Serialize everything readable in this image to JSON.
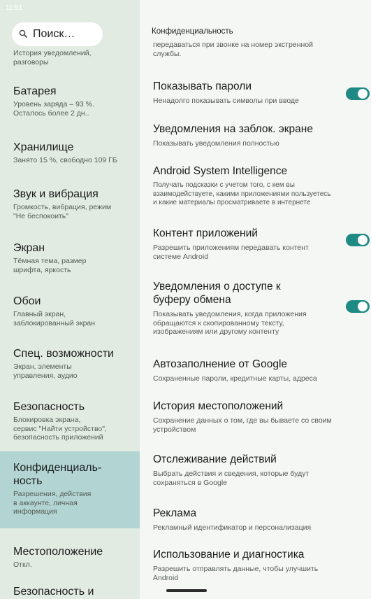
{
  "status": {
    "time": "11:51",
    "battery_glyph": "▮"
  },
  "search": {
    "placeholder": "Поиск…"
  },
  "sidebar": {
    "items": [
      {
        "title": "",
        "subtitle": "История уведомлений,\nразговоры"
      },
      {
        "title": "Батарея",
        "subtitle": "Уровень заряда – 93 %.\nОсталось более 2 дн.."
      },
      {
        "title": "Хранилище",
        "subtitle": "Занято 15 %, свободно 109 ГБ"
      },
      {
        "title": "Звук и вибрация",
        "subtitle": "Громкость, вибрация, режим\n\"Не беспокоить\""
      },
      {
        "title": "Экран",
        "subtitle": "Тёмная тема, размер\nшрифта, яркость"
      },
      {
        "title": "Обои",
        "subtitle": "Главный экран,\nзаблокированный экран"
      },
      {
        "title": "Спец. возможности",
        "subtitle": "Экран, элементы\nуправления, аудио"
      },
      {
        "title": "Безопасность",
        "subtitle": "Блокировка экрана,\nсервис \"Найти устройство\",\nбезопасность приложений"
      },
      {
        "title": "Конфиденциаль-\nность",
        "subtitle": "Разрешения, действия\nв аккаунте, личная\nинформация"
      },
      {
        "title": "Местоположение",
        "subtitle": "Откл."
      },
      {
        "title": "Безопасность и",
        "subtitle": ""
      }
    ]
  },
  "main": {
    "header": "Конфиденциальность",
    "partial_top": "передаваться при звонке на номер экстренной\nслужбы.",
    "rows": [
      {
        "title": "Показывать пароли",
        "subtitle": "Ненадолго показывать символы при вводе",
        "toggle": true
      },
      {
        "title": "Уведомления на заблок. экране",
        "subtitle": "Показывать уведомления полностью"
      },
      {
        "title": "Android System Intelligence",
        "subtitle": "Получать подсказки с учетом того, с кем вы\nвзаимодействуете, какими приложениями пользуетесь\nи какие материалы просматриваете в интернете"
      },
      {
        "title": "Контент приложений",
        "subtitle": "Разрешить приложениям передавать контент\nсистеме Android",
        "toggle": true
      },
      {
        "title": "Уведомления о доступе к\nбуферу обмена",
        "subtitle": "Показывать уведомления, когда приложения\nобращаются к скопированному тексту,\nизображениям или другому контенту",
        "toggle": true
      },
      {
        "title": "Автозаполнение от Google",
        "subtitle": "Сохраненные пароли, кредитные карты, адреса"
      },
      {
        "title": "История местоположений",
        "subtitle": "Сохранение данных о том, где вы бываете со своим\nустройством"
      },
      {
        "title": "Отслеживание действий",
        "subtitle": "Выбрать действия и сведения, которые будут\nсохраняться в Google"
      },
      {
        "title": "Реклама",
        "subtitle": "Рекламный идентификатор и персонализация"
      },
      {
        "title": "Использование и диагностика",
        "subtitle": "Разрешить отправлять данные, чтобы улучшить\nAndroid"
      }
    ]
  },
  "colors": {
    "accent": "#1e8a83",
    "sidebar_bg": "#e2ebe2",
    "active_bg": "#b2d5d3",
    "main_bg": "#f4f7f4"
  },
  "icons": {
    "search": "search-icon"
  }
}
